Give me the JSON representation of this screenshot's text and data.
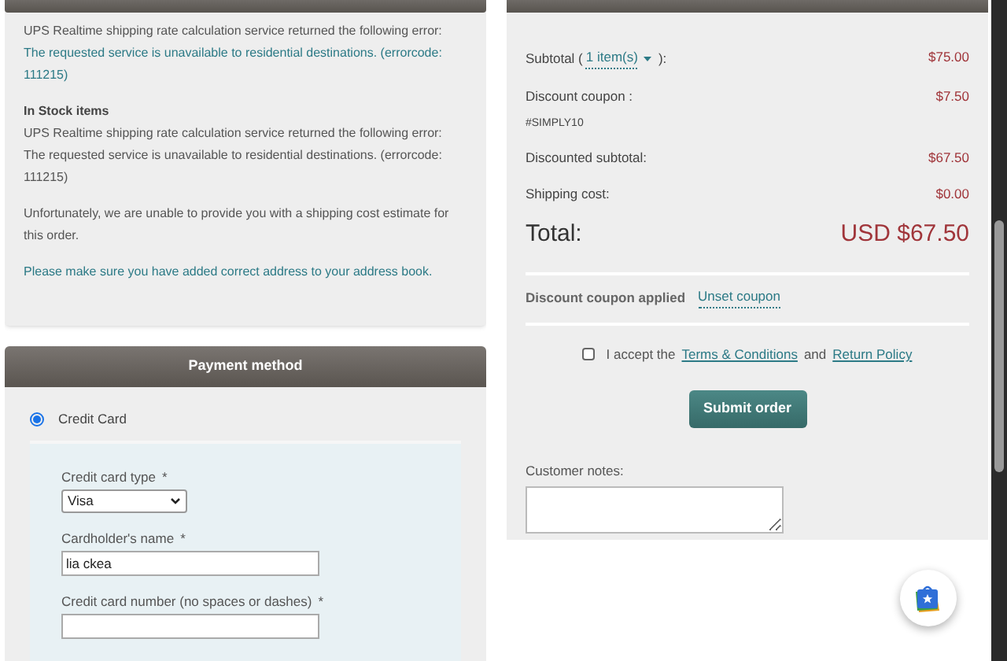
{
  "shipping": {
    "blocks": [
      {
        "lines": [
          {
            "text": "UPS Realtime shipping rate calculation service returned the following error:",
            "kind": "plain"
          },
          {
            "text": "The requested service is unavailable to residential destinations. (errorcode: 111215)",
            "kind": "highlight"
          }
        ]
      },
      {
        "heading": "In Stock items",
        "lines": [
          {
            "text": "UPS Realtime shipping rate calculation service returned the following error:",
            "kind": "plain"
          },
          {
            "text": "The requested service is unavailable to residential destinations. (errorcode: 111215)",
            "kind": "plain"
          }
        ]
      },
      {
        "lines": [
          {
            "text": "Unfortunately, we are unable to provide you with a shipping cost estimate for this order.",
            "kind": "plain"
          }
        ]
      },
      {
        "lines": [
          {
            "text": "Please make sure you have added correct address to your address book.",
            "kind": "highlight"
          }
        ]
      }
    ]
  },
  "payment": {
    "title": "Payment method",
    "options": [
      {
        "label": "Credit Card",
        "selected": true
      }
    ],
    "fields": [
      {
        "kind": "select",
        "label": "Credit card type",
        "mark": "*",
        "value": "Visa"
      },
      {
        "kind": "text",
        "label": "Cardholder's name",
        "mark": "*",
        "value": "lia ckea"
      },
      {
        "kind": "text",
        "label": "Credit card number (no spaces or dashes)",
        "mark": "*"
      }
    ]
  },
  "summary": {
    "subtotal": {
      "before": "Subtotal (",
      "link": "1 item(s)",
      "after": "):",
      "value": "$75.00"
    },
    "rows": [
      {
        "label": "Discount coupon :",
        "sub": "#SIMPLY10",
        "value": "$7.50"
      },
      {
        "label": "Discounted subtotal:",
        "value": "$67.50"
      },
      {
        "label": "Shipping cost:",
        "value": "$0.00"
      }
    ],
    "total": {
      "label": "Total:",
      "value": "USD $67.50"
    },
    "coupon": {
      "text": "Discount coupon applied",
      "link": "Unset coupon"
    },
    "terms": {
      "checked": false,
      "before": "I accept the",
      "link1": "Terms & Conditions",
      "middle": "and",
      "link2": "Return Policy"
    },
    "submit": "Submit order",
    "notes": {
      "label": "Customer notes:"
    }
  }
}
